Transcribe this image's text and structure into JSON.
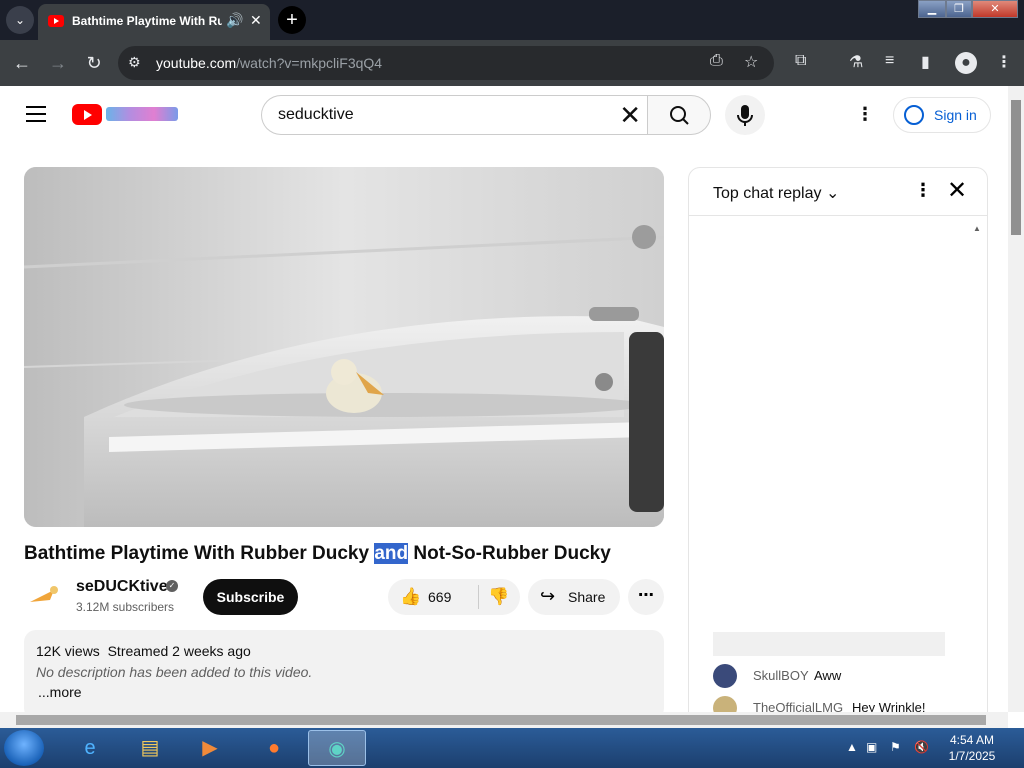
{
  "browser": {
    "tab_title": "Bathtime Playtime With Ru",
    "url_host": "youtube.com",
    "url_path": "/watch?v=mkpcliF3qQ4",
    "window_controls": [
      "minimize",
      "restore",
      "close"
    ]
  },
  "header": {
    "search_value": "seducktive",
    "sign_in_label": "Sign in"
  },
  "video": {
    "title_before": "Bathtime Playtime With Rubber Ducky ",
    "title_highlight": "and",
    "title_after": " Not-So-Rubber Ducky",
    "channel_name": "seDUCKtive",
    "subscribers": "3.12M subscribers",
    "subscribe_label": "Subscribe",
    "like_count": "669",
    "share_label": "Share",
    "views": "12K views",
    "streamed": "Streamed 2 weeks ago",
    "description": "No description has been added to this video.",
    "more_label": "...more"
  },
  "chat": {
    "header_label": "Top chat replay",
    "messages": [
      {
        "author": "SkullBOY",
        "text": "Aww",
        "avatar_color": "#3a4a7a"
      },
      {
        "author": "TheOfficialLMG",
        "text": "Hey Wrinkle!",
        "avatar_color": "#c9b27a"
      }
    ]
  },
  "taskbar": {
    "time": "4:54 AM",
    "date": "1/7/2025",
    "apps": [
      "internet-explorer-icon",
      "folder-icon",
      "media-player-icon",
      "firefox-icon",
      "active-app-icon"
    ]
  },
  "colors": {
    "youtube_red": "#ff0000",
    "link_blue": "#065fd4",
    "selection_blue": "#3366cc"
  }
}
